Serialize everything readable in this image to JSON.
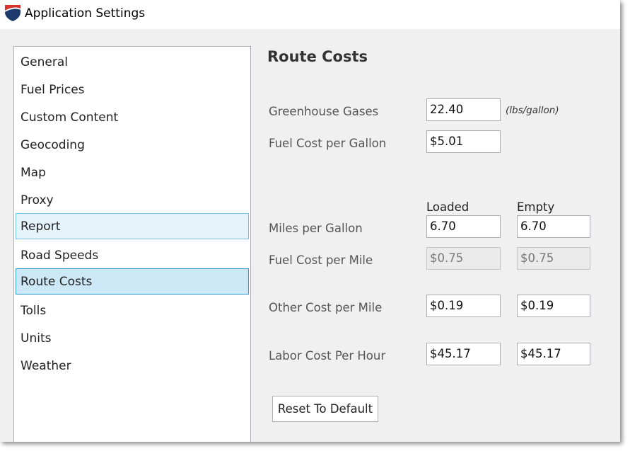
{
  "window": {
    "title": "Application Settings"
  },
  "sidebar": {
    "items": [
      {
        "label": "General"
      },
      {
        "label": "Fuel Prices"
      },
      {
        "label": "Custom Content"
      },
      {
        "label": "Geocoding"
      },
      {
        "label": "Map"
      },
      {
        "label": "Proxy"
      },
      {
        "label": "Report",
        "state": "hover"
      },
      {
        "label": "Road Speeds"
      },
      {
        "label": "Route Costs",
        "state": "selected"
      },
      {
        "label": "Tolls"
      },
      {
        "label": "Units"
      },
      {
        "label": "Weather"
      }
    ]
  },
  "content": {
    "title": "Route Costs",
    "greenhouse": {
      "label": "Greenhouse Gases",
      "value": "22.40",
      "unit": "(lbs/gallon)"
    },
    "fuel_cost_gallon": {
      "label": "Fuel Cost per Gallon",
      "value": "$5.01"
    },
    "columns": {
      "loaded": "Loaded",
      "empty": "Empty"
    },
    "mpg": {
      "label": "Miles per Gallon",
      "loaded": "6.70",
      "empty": "6.70"
    },
    "fuel_cost_mile": {
      "label": "Fuel Cost per Mile",
      "loaded": "$0.75",
      "empty": "$0.75"
    },
    "other_cost_mile": {
      "label": "Other Cost per Mile",
      "loaded": "$0.19",
      "empty": "$0.19"
    },
    "labor_cost_hour": {
      "label": "Labor Cost Per Hour",
      "loaded": "$45.17",
      "empty": "$45.17"
    },
    "reset_label": "Reset To Default"
  },
  "colors": {
    "hover_bg": "#e5f3fb",
    "hover_border": "#70c0e7",
    "selected_bg": "#cce8f7",
    "selected_border": "#3399c9",
    "icon_red": "#d9342b",
    "icon_navy": "#1f3b6e"
  },
  "icons": {
    "app": "shield-icon"
  }
}
